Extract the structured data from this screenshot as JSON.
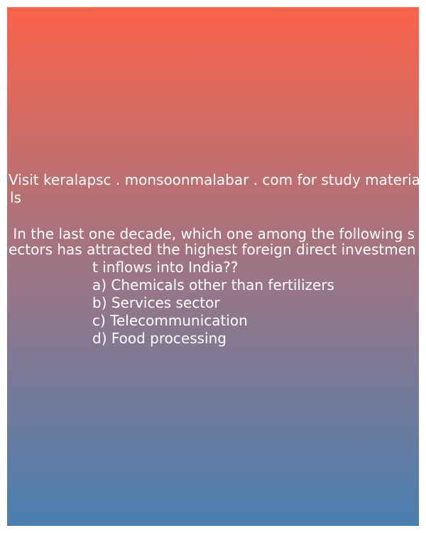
{
  "promo": {
    "line1": "Visit keralapsc . monsoonmalabar . com for study materia",
    "line2": "ls"
  },
  "question": {
    "line1": " In the last one decade, which one among the following s",
    "line2": "ectors has attracted the highest foreign direct investmen",
    "line3": "t inflows into India??"
  },
  "options": [
    "a) Chemicals other than fertilizers",
    "b) Services sector",
    "c) Telecommunication",
    "d) Food processing"
  ],
  "colors": {
    "gradient_top": "#fb634a",
    "gradient_mid": "#9e7584",
    "gradient_bottom": "#4a7fb0",
    "text": "#ffffff"
  }
}
